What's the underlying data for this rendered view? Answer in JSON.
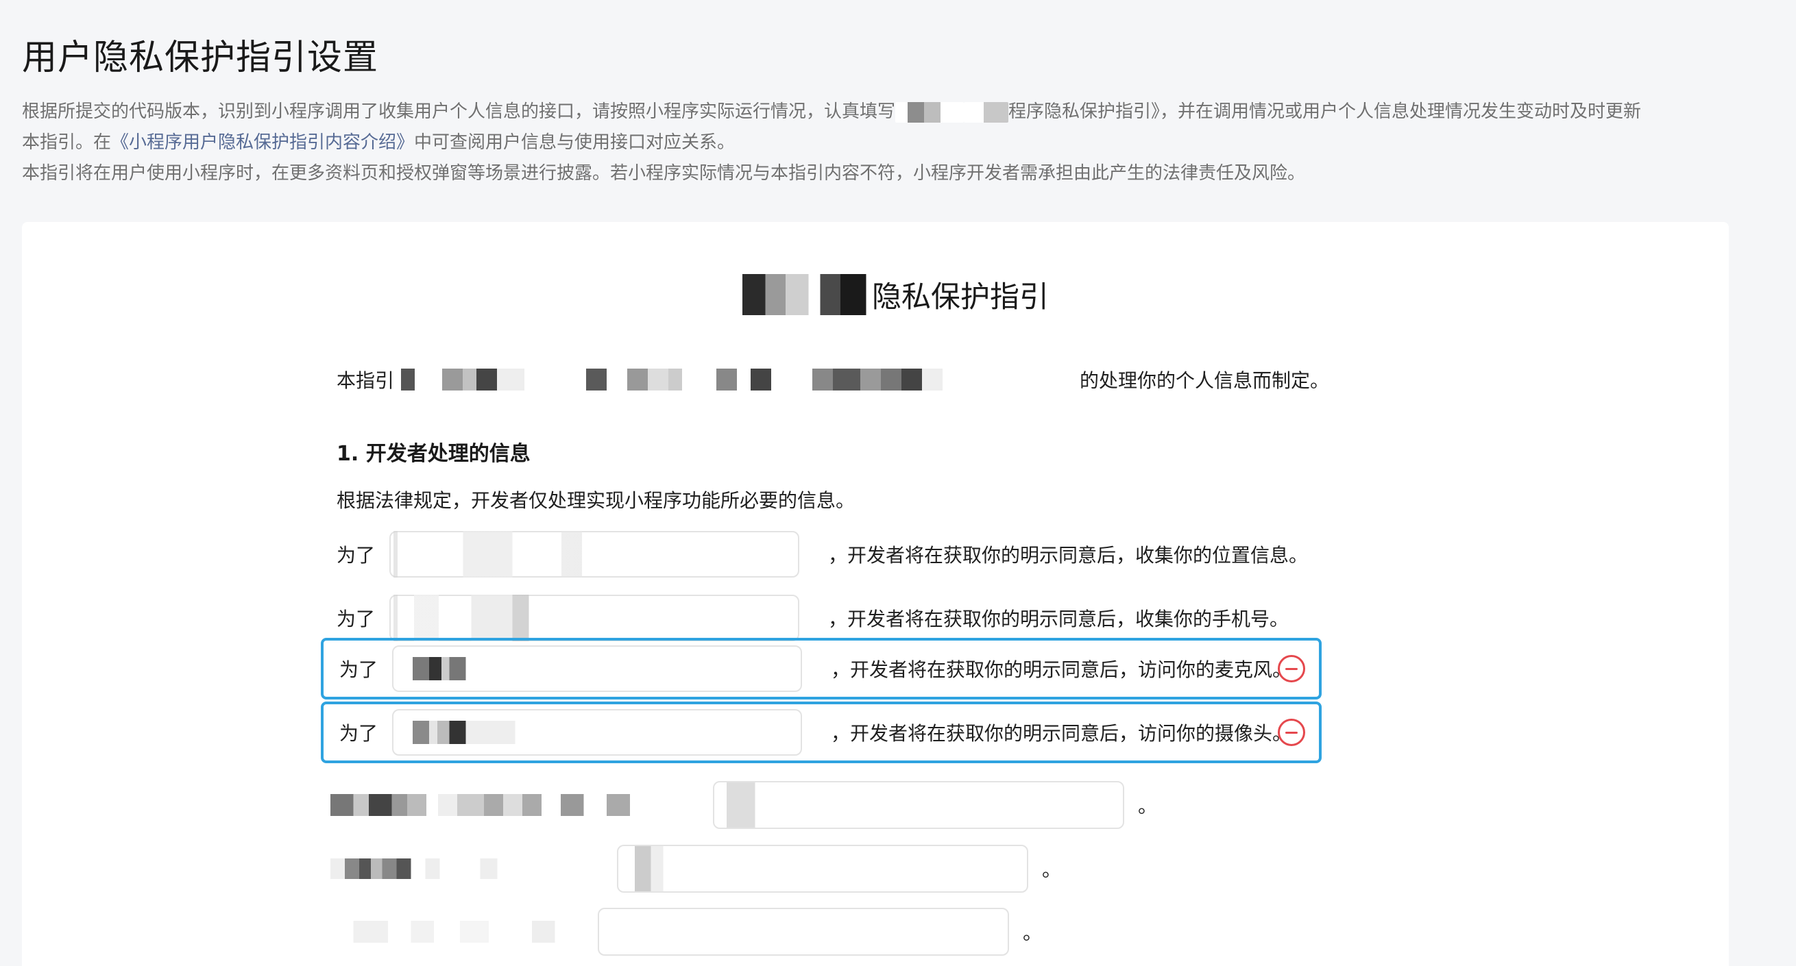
{
  "page": {
    "title": "用户隐私保护指引设置"
  },
  "intro": {
    "line1_a": "根据所提交的代码版本，识别到小程序调用了收集用户个人信息的接口，请按照小程序实际运行情况，认真填写",
    "line1_b": "程序隐私保护指引》，并在调用情况或用户个人信息处理情况发生变动时及时更新",
    "line2_a": "本指引。在",
    "line2_link": "《小程序用户隐私保护指引内容介绍》",
    "line2_b": "中可查阅用户信息与使用接口对应关系。",
    "line3": "本指引将在用户使用小程序时，在更多资料页和授权弹窗等场景进行披露。若小程序实际情况与本指引内容不符，小程序开发者需承担由此产生的法律责任及风险。"
  },
  "guide": {
    "title_suffix": "隐私保护指引",
    "desc_prefix": "本指引",
    "desc_suffix": "的处理你的个人信息而制定。",
    "section_title": "1.  开发者处理的信息",
    "section_desc": "根据法律规定，开发者仅处理实现小程序功能所必要的信息。"
  },
  "rows": [
    {
      "prefix": "为了",
      "suffix": "，开发者将在获取你的明示同意后，收集你的位置信息。",
      "value": "",
      "selected": false
    },
    {
      "prefix": "为了",
      "suffix": "，开发者将在获取你的明示同意后，收集你的手机号。",
      "value": "",
      "selected": false
    },
    {
      "prefix": "为了",
      "suffix": "，开发者将在获取你的明示同意后，访问你的麦克风。",
      "value": "",
      "selected": true
    },
    {
      "prefix": "为了",
      "suffix": "，开发者将在获取你的明示同意后，访问你的摄像头。",
      "value": "",
      "selected": true
    }
  ],
  "extra_rows": [
    {
      "end": "。"
    },
    {
      "end": "。"
    },
    {
      "end": "。"
    }
  ],
  "colors": {
    "selected_border": "#2fa3e0",
    "remove_red": "#e5484d",
    "link": "#576b95"
  },
  "icons": {
    "remove": "minus-circle-icon"
  }
}
